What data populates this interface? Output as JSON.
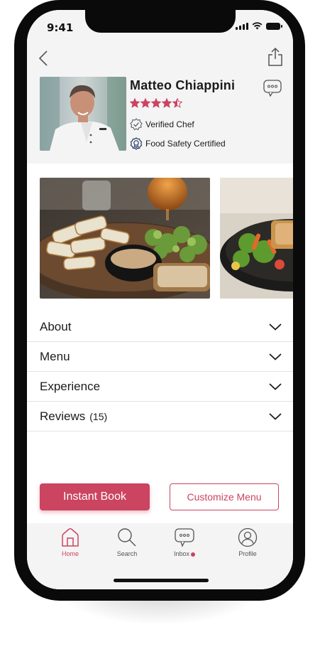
{
  "status_bar": {
    "time": "9:41"
  },
  "chef": {
    "name": "Matteo Chiappini",
    "rating": 4.5,
    "badges": [
      "Verified Chef",
      "Food Safety Certified"
    ]
  },
  "accordion": [
    {
      "label": "About",
      "count": ""
    },
    {
      "label": "Menu",
      "count": ""
    },
    {
      "label": "Experience",
      "count": ""
    },
    {
      "label": "Reviews",
      "count": "(15)"
    }
  ],
  "actions": {
    "primary": "Instant Book",
    "secondary": "Customize Menu"
  },
  "tabs": [
    {
      "label": "Home",
      "icon": "home-icon"
    },
    {
      "label": "Search",
      "icon": "search-icon"
    },
    {
      "label": "Inbox",
      "icon": "inbox-icon"
    },
    {
      "label": "Profile",
      "icon": "profile-icon"
    }
  ],
  "colors": {
    "accent": "#cb4460",
    "header_bg": "#f4f4f5"
  }
}
